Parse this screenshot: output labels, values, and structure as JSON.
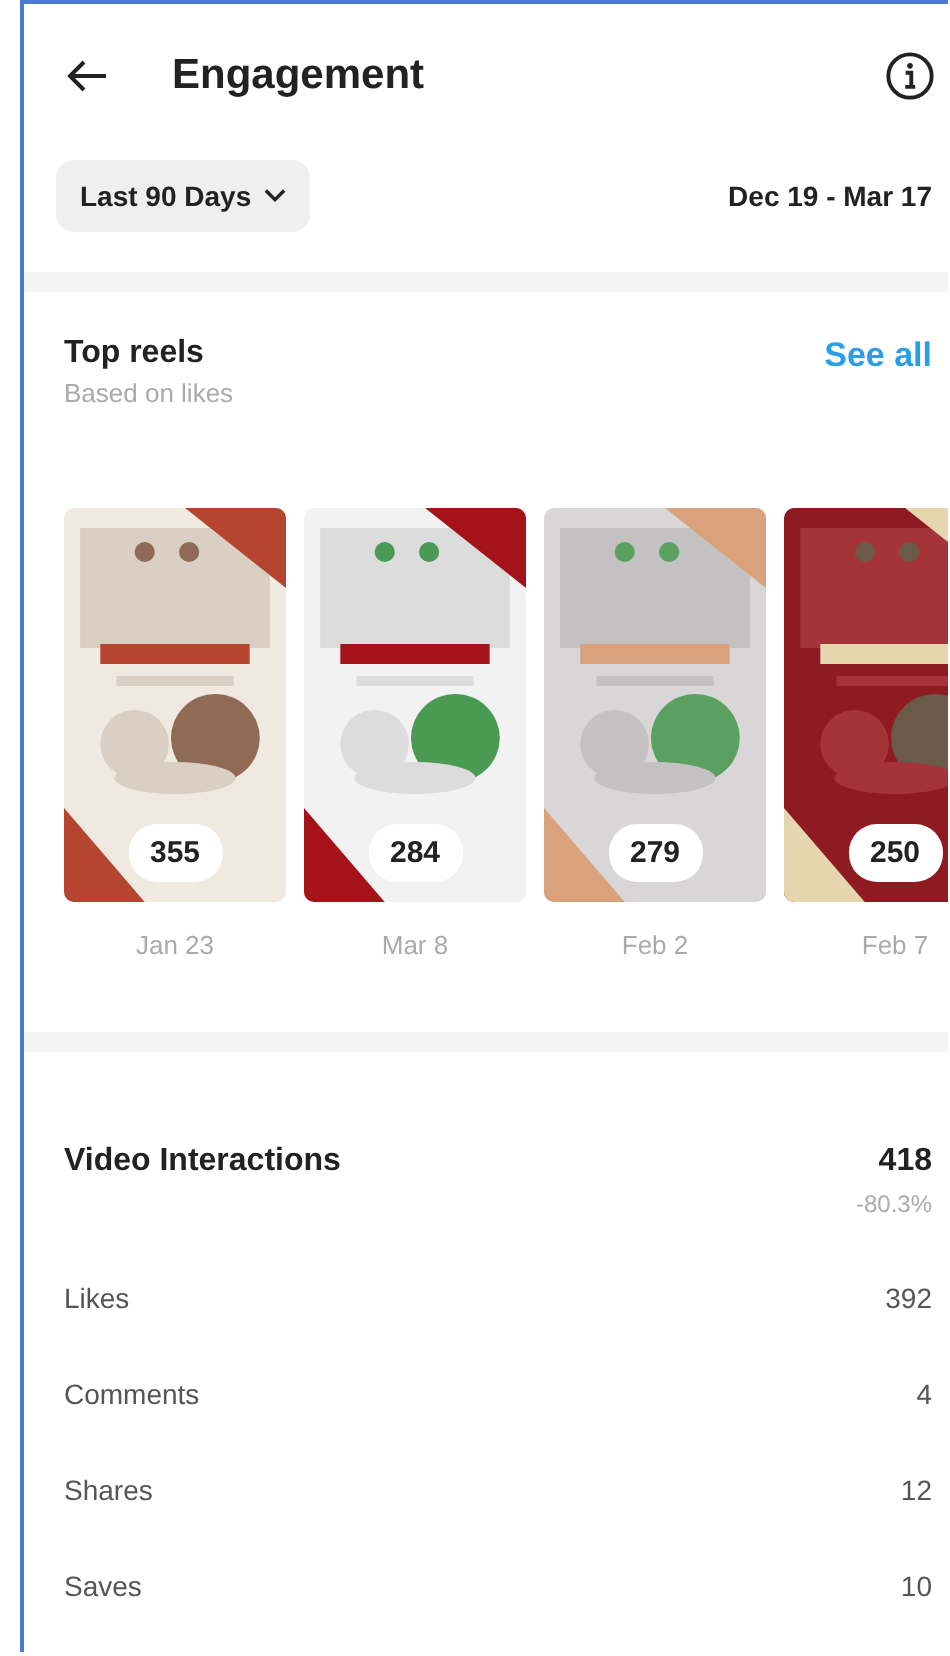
{
  "header": {
    "title": "Engagement"
  },
  "filter": {
    "range": "Last 90 Days",
    "dates": "Dec 19 - Mar 17"
  },
  "top_reels": {
    "title": "Top reels",
    "subtitle": "Based on likes",
    "link": "See all",
    "reels": [
      {
        "kind": "picture",
        "count": "355",
        "date": "Jan 23"
      },
      {
        "kind": "picture",
        "count": "284",
        "date": "Mar 8"
      },
      {
        "kind": "picture",
        "count": "279",
        "date": "Feb 2"
      },
      {
        "kind": "picture",
        "count": "250",
        "date": "Feb 7"
      }
    ]
  },
  "interactions": {
    "title": "Video Interactions",
    "total": "418",
    "change": "-80.3%",
    "rows": [
      {
        "label": "Likes",
        "value": "392"
      },
      {
        "label": "Comments",
        "value": "4"
      },
      {
        "label": "Shares",
        "value": "12"
      },
      {
        "label": "Saves",
        "value": "10"
      }
    ]
  }
}
